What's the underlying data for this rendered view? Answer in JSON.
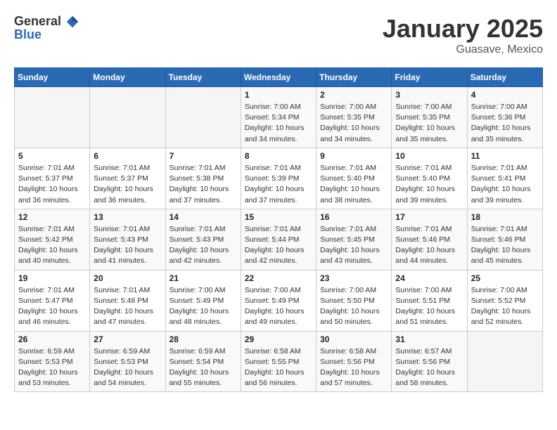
{
  "header": {
    "logo_general": "General",
    "logo_blue": "Blue",
    "month": "January 2025",
    "location": "Guasave, Mexico"
  },
  "weekdays": [
    "Sunday",
    "Monday",
    "Tuesday",
    "Wednesday",
    "Thursday",
    "Friday",
    "Saturday"
  ],
  "weeks": [
    [
      {
        "day": "",
        "info": ""
      },
      {
        "day": "",
        "info": ""
      },
      {
        "day": "",
        "info": ""
      },
      {
        "day": "1",
        "info": "Sunrise: 7:00 AM\nSunset: 5:34 PM\nDaylight: 10 hours\nand 34 minutes."
      },
      {
        "day": "2",
        "info": "Sunrise: 7:00 AM\nSunset: 5:35 PM\nDaylight: 10 hours\nand 34 minutes."
      },
      {
        "day": "3",
        "info": "Sunrise: 7:00 AM\nSunset: 5:35 PM\nDaylight: 10 hours\nand 35 minutes."
      },
      {
        "day": "4",
        "info": "Sunrise: 7:00 AM\nSunset: 5:36 PM\nDaylight: 10 hours\nand 35 minutes."
      }
    ],
    [
      {
        "day": "5",
        "info": "Sunrise: 7:01 AM\nSunset: 5:37 PM\nDaylight: 10 hours\nand 36 minutes."
      },
      {
        "day": "6",
        "info": "Sunrise: 7:01 AM\nSunset: 5:37 PM\nDaylight: 10 hours\nand 36 minutes."
      },
      {
        "day": "7",
        "info": "Sunrise: 7:01 AM\nSunset: 5:38 PM\nDaylight: 10 hours\nand 37 minutes."
      },
      {
        "day": "8",
        "info": "Sunrise: 7:01 AM\nSunset: 5:39 PM\nDaylight: 10 hours\nand 37 minutes."
      },
      {
        "day": "9",
        "info": "Sunrise: 7:01 AM\nSunset: 5:40 PM\nDaylight: 10 hours\nand 38 minutes."
      },
      {
        "day": "10",
        "info": "Sunrise: 7:01 AM\nSunset: 5:40 PM\nDaylight: 10 hours\nand 39 minutes."
      },
      {
        "day": "11",
        "info": "Sunrise: 7:01 AM\nSunset: 5:41 PM\nDaylight: 10 hours\nand 39 minutes."
      }
    ],
    [
      {
        "day": "12",
        "info": "Sunrise: 7:01 AM\nSunset: 5:42 PM\nDaylight: 10 hours\nand 40 minutes."
      },
      {
        "day": "13",
        "info": "Sunrise: 7:01 AM\nSunset: 5:43 PM\nDaylight: 10 hours\nand 41 minutes."
      },
      {
        "day": "14",
        "info": "Sunrise: 7:01 AM\nSunset: 5:43 PM\nDaylight: 10 hours\nand 42 minutes."
      },
      {
        "day": "15",
        "info": "Sunrise: 7:01 AM\nSunset: 5:44 PM\nDaylight: 10 hours\nand 42 minutes."
      },
      {
        "day": "16",
        "info": "Sunrise: 7:01 AM\nSunset: 5:45 PM\nDaylight: 10 hours\nand 43 minutes."
      },
      {
        "day": "17",
        "info": "Sunrise: 7:01 AM\nSunset: 5:46 PM\nDaylight: 10 hours\nand 44 minutes."
      },
      {
        "day": "18",
        "info": "Sunrise: 7:01 AM\nSunset: 5:46 PM\nDaylight: 10 hours\nand 45 minutes."
      }
    ],
    [
      {
        "day": "19",
        "info": "Sunrise: 7:01 AM\nSunset: 5:47 PM\nDaylight: 10 hours\nand 46 minutes."
      },
      {
        "day": "20",
        "info": "Sunrise: 7:01 AM\nSunset: 5:48 PM\nDaylight: 10 hours\nand 47 minutes."
      },
      {
        "day": "21",
        "info": "Sunrise: 7:00 AM\nSunset: 5:49 PM\nDaylight: 10 hours\nand 48 minutes."
      },
      {
        "day": "22",
        "info": "Sunrise: 7:00 AM\nSunset: 5:49 PM\nDaylight: 10 hours\nand 49 minutes."
      },
      {
        "day": "23",
        "info": "Sunrise: 7:00 AM\nSunset: 5:50 PM\nDaylight: 10 hours\nand 50 minutes."
      },
      {
        "day": "24",
        "info": "Sunrise: 7:00 AM\nSunset: 5:51 PM\nDaylight: 10 hours\nand 51 minutes."
      },
      {
        "day": "25",
        "info": "Sunrise: 7:00 AM\nSunset: 5:52 PM\nDaylight: 10 hours\nand 52 minutes."
      }
    ],
    [
      {
        "day": "26",
        "info": "Sunrise: 6:59 AM\nSunset: 5:53 PM\nDaylight: 10 hours\nand 53 minutes."
      },
      {
        "day": "27",
        "info": "Sunrise: 6:59 AM\nSunset: 5:53 PM\nDaylight: 10 hours\nand 54 minutes."
      },
      {
        "day": "28",
        "info": "Sunrise: 6:59 AM\nSunset: 5:54 PM\nDaylight: 10 hours\nand 55 minutes."
      },
      {
        "day": "29",
        "info": "Sunrise: 6:58 AM\nSunset: 5:55 PM\nDaylight: 10 hours\nand 56 minutes."
      },
      {
        "day": "30",
        "info": "Sunrise: 6:58 AM\nSunset: 5:56 PM\nDaylight: 10 hours\nand 57 minutes."
      },
      {
        "day": "31",
        "info": "Sunrise: 6:57 AM\nSunset: 5:56 PM\nDaylight: 10 hours\nand 58 minutes."
      },
      {
        "day": "",
        "info": ""
      }
    ]
  ]
}
